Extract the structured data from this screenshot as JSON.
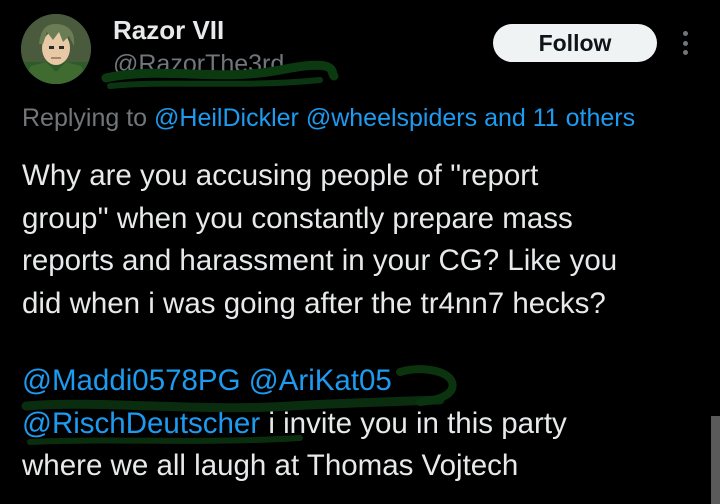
{
  "author": {
    "display_name": "Razor VII",
    "handle": "@RazorThe3rd"
  },
  "actions": {
    "follow_label": "Follow",
    "more_icon": "more-vertical-icon"
  },
  "reply_context": {
    "prefix": "Replying to",
    "mention_1": "@HeilDickler",
    "mention_2": "@wheelspiders",
    "suffix": "and 11 others"
  },
  "tweet": {
    "line_1": "Why are you accusing people of ''report",
    "line_2": "group'' when you constantly prepare mass",
    "line_3": "reports and harassment in your CG? Like you",
    "line_4": "did when i was going after the tr4nn7 hecks?",
    "mention_a": "@Maddi0578PG",
    "mention_b": "@AriKat05",
    "mention_c": "@RischDeutscher",
    "line_6_rest": "i invite you in this party",
    "line_7": "where we all laugh at Thomas Vojtech"
  },
  "colors": {
    "background": "#000000",
    "text": "#e7e9ea",
    "muted": "#71767b",
    "link": "#1d9bf0",
    "scribble": "#0c3a10"
  }
}
